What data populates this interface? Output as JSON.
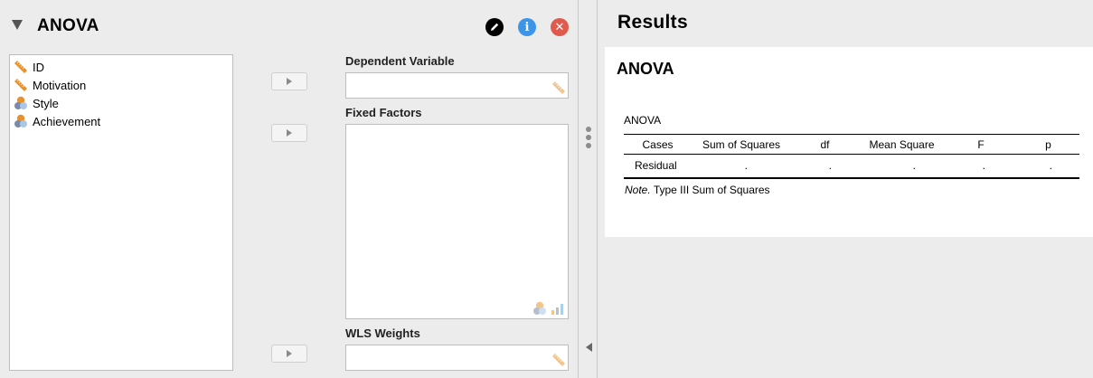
{
  "analysis_panel": {
    "title": "ANOVA",
    "variables": [
      {
        "name": "ID",
        "icon": "scale-ruler-icon"
      },
      {
        "name": "Motivation",
        "icon": "scale-ruler-icon"
      },
      {
        "name": "Style",
        "icon": "nominal-circles-icon"
      },
      {
        "name": "Achievement",
        "icon": "nominal-circles-icon"
      }
    ],
    "dependent_variable_label": "Dependent Variable",
    "fixed_factors_label": "Fixed Factors",
    "wls_weights_label": "WLS Weights",
    "info_glyph": "i",
    "close_glyph": "✕"
  },
  "results": {
    "header": "Results",
    "analysis_title": "ANOVA",
    "table_title": "ANOVA",
    "columns": [
      "Cases",
      "Sum of Squares",
      "df",
      "Mean Square",
      "F",
      "p"
    ],
    "rows": [
      {
        "cases": "Residual",
        "sum_of_squares": ".",
        "df": ".",
        "mean_square": ".",
        "f": ".",
        "p": "."
      }
    ],
    "note_label": "Note.",
    "note_text": "Type III Sum of Squares"
  },
  "colors": {
    "info_button": "#3c95e8",
    "close_button": "#e05a4e",
    "scale_icon": "#e8922e",
    "background": "#ececec"
  }
}
